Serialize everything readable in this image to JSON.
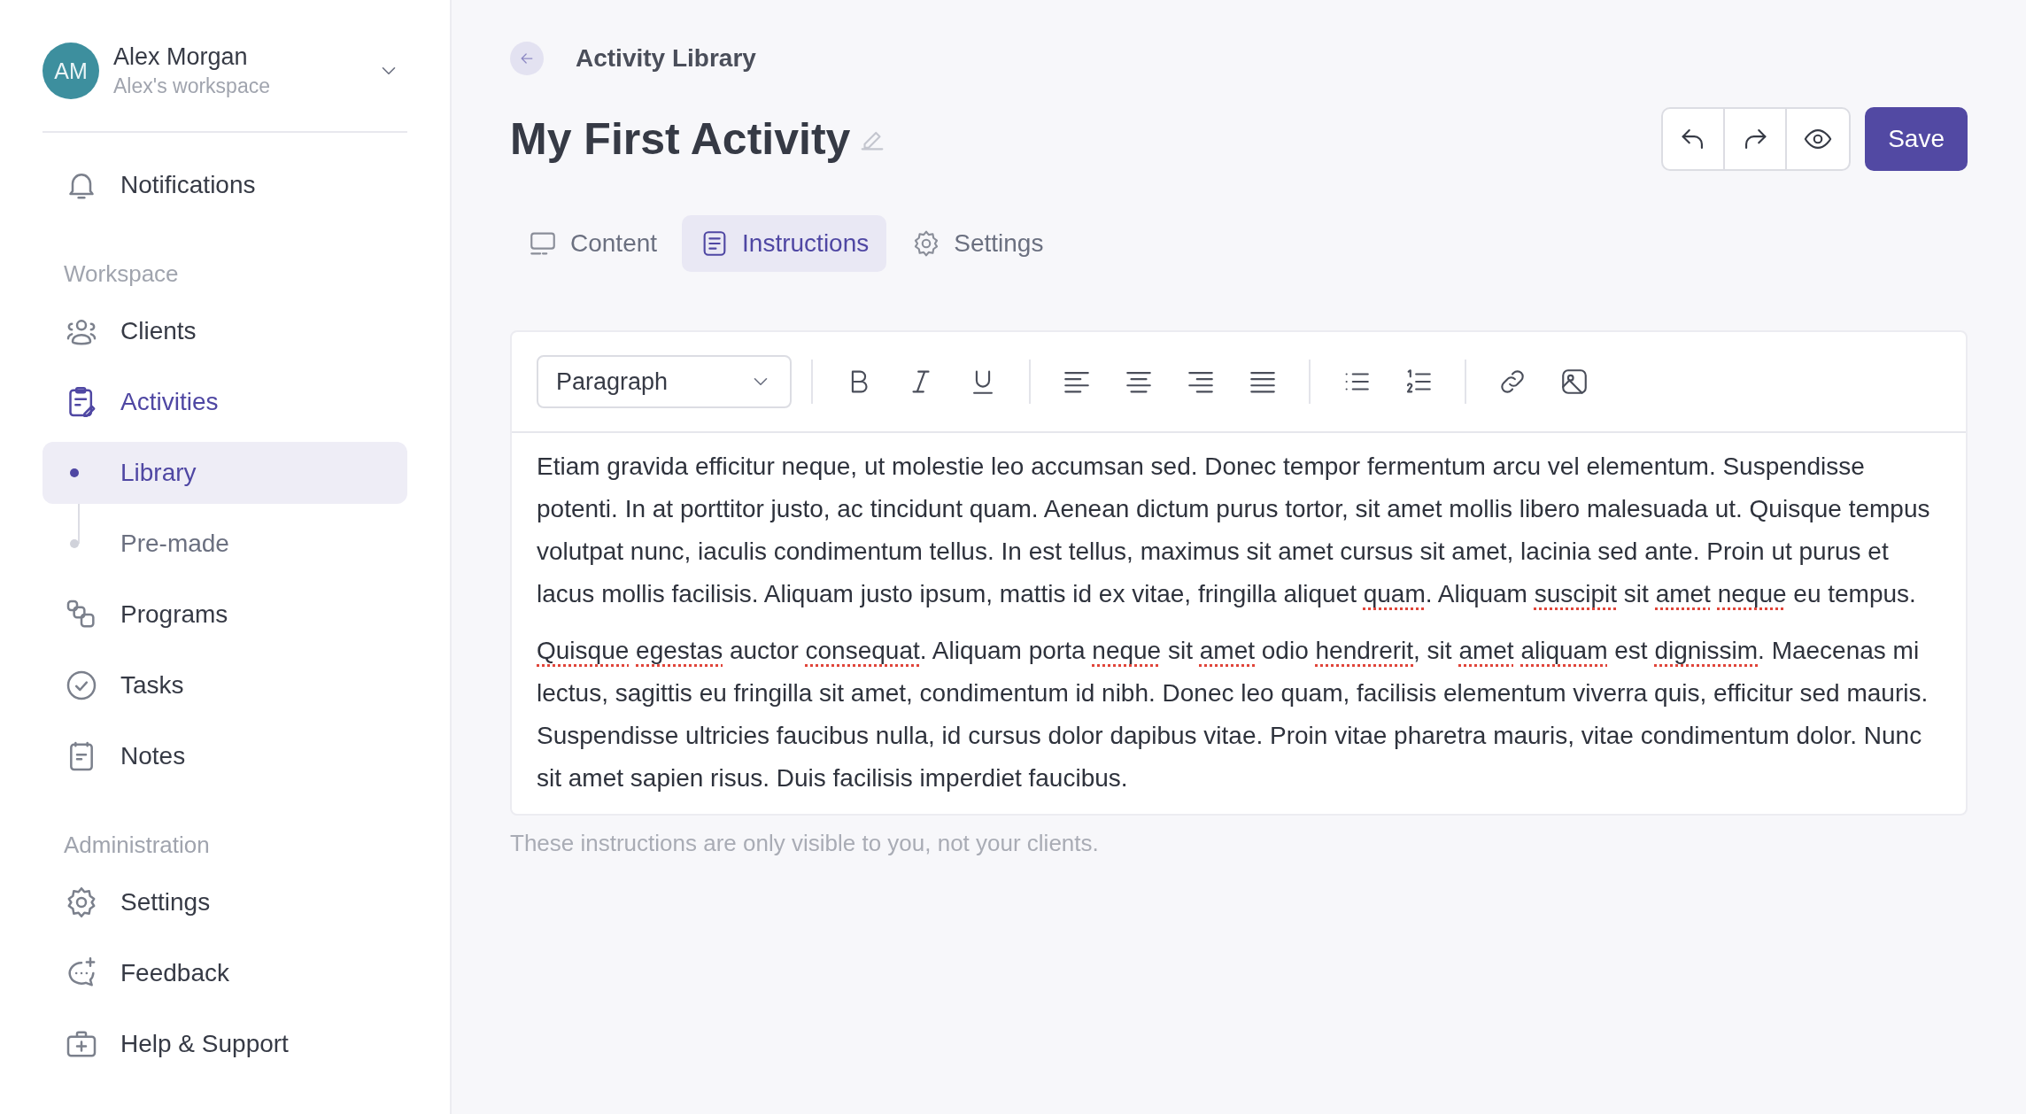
{
  "sidebar": {
    "user": {
      "initials": "AM",
      "name": "Alex Morgan",
      "workspace": "Alex's workspace"
    },
    "sections": [
      {
        "items": [
          {
            "label": "Notifications",
            "selected": false
          }
        ]
      },
      {
        "heading": "Workspace",
        "items": [
          {
            "label": "Clients",
            "selected": false
          },
          {
            "label": "Activities",
            "selected": true,
            "children": [
              {
                "label": "Library",
                "selected": true
              },
              {
                "label": "Pre-made",
                "selected": false
              }
            ]
          },
          {
            "label": "Programs",
            "selected": false
          },
          {
            "label": "Tasks",
            "selected": false
          },
          {
            "label": "Notes",
            "selected": false
          }
        ]
      },
      {
        "heading": "Administration",
        "items": [
          {
            "label": "Settings",
            "selected": false
          },
          {
            "label": "Feedback",
            "selected": false
          },
          {
            "label": "Help & Support",
            "selected": false
          }
        ]
      }
    ]
  },
  "breadcrumb": "Activity Library",
  "title": "My First Activity",
  "actions": {
    "save": "Save"
  },
  "tabs": [
    {
      "label": "Content",
      "selected": false
    },
    {
      "label": "Instructions",
      "selected": true
    },
    {
      "label": "Settings",
      "selected": false
    }
  ],
  "editor": {
    "block_type": "Paragraph",
    "paragraphs": [
      [
        {
          "text": "Etiam gravida efficitur neque, ut molestie leo accumsan sed. Donec tempor fermentum arcu vel elementum. Suspendisse potenti. In at porttitor justo, ac tincidunt quam. Aenean dictum purus tortor, sit amet mollis libero malesuada ut. Quisque tempus volutpat nunc, iaculis condimentum tellus. In est tellus, maximus sit amet cursus sit amet, lacinia sed ante. Proin ut purus et lacus mollis facilisis. Aliquam justo ipsum, mattis id ex vitae, fringilla aliquet ",
          "misspelled": false
        },
        {
          "text": "quam",
          "misspelled": true
        },
        {
          "text": ". Aliquam ",
          "misspelled": false
        },
        {
          "text": "suscipit",
          "misspelled": true
        },
        {
          "text": " sit ",
          "misspelled": false
        },
        {
          "text": "amet",
          "misspelled": true
        },
        {
          "text": " neque",
          "misspelled": true
        },
        {
          "text": " eu tempus.",
          "misspelled": false
        }
      ],
      [
        {
          "text": "Quisque",
          "misspelled": true
        },
        {
          "text": " egestas",
          "misspelled": true
        },
        {
          "text": " auctor ",
          "misspelled": false
        },
        {
          "text": "consequat",
          "misspelled": true
        },
        {
          "text": ". Aliquam porta ",
          "misspelled": false
        },
        {
          "text": "neque",
          "misspelled": true
        },
        {
          "text": " sit ",
          "misspelled": false
        },
        {
          "text": "amet",
          "misspelled": true
        },
        {
          "text": " odio ",
          "misspelled": false
        },
        {
          "text": "hendrerit",
          "misspelled": true
        },
        {
          "text": ", sit ",
          "misspelled": false
        },
        {
          "text": "amet",
          "misspelled": true
        },
        {
          "text": " aliquam",
          "misspelled": true
        },
        {
          "text": " est ",
          "misspelled": false
        },
        {
          "text": "dignissim",
          "misspelled": true
        },
        {
          "text": ". Maecenas mi lectus, sagittis eu fringilla sit amet, condimentum id nibh. Donec leo quam, facilisis elementum viverra quis, efficitur sed mauris. Suspendisse ultricies faucibus nulla, id cursus dolor dapibus vitae. Proin vitae pharetra mauris, vitae condimentum dolor. Nunc sit amet sapien risus. Duis facilisis imperdiet faucibus.",
          "misspelled": false
        }
      ]
    ]
  },
  "footnote": "These instructions are only visible to you, not your clients."
}
